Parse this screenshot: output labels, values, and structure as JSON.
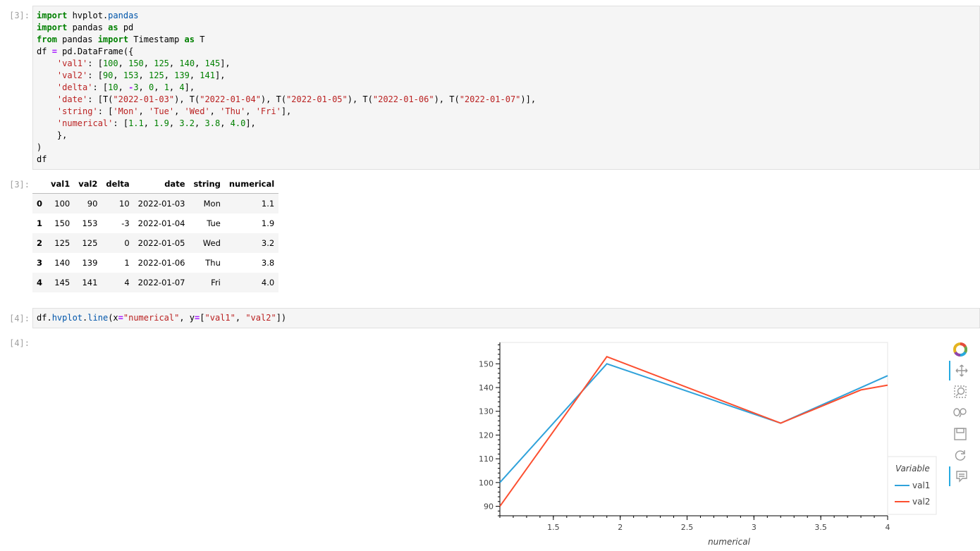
{
  "cells": [
    {
      "prompt": "[3]:",
      "code_lines": [
        "import hvplot.pandas",
        "import pandas as pd",
        "from pandas import Timestamp as T",
        "df = pd.DataFrame({",
        "    'val1': [100, 150, 125, 140, 145],",
        "    'val2': [90, 153, 125, 139, 141],",
        "    'delta': [10, -3, 0, 1, 4],",
        "    'date': [T(\"2022-01-03\"), T(\"2022-01-04\"), T(\"2022-01-05\"), T(\"2022-01-06\"), T(\"2022-01-07\")],",
        "    'string': ['Mon', 'Tue', 'Wed', 'Thu', 'Fri'],",
        "    'numerical': [1.1, 1.9, 3.2, 3.8, 4.0],",
        "    },",
        ")",
        "df"
      ]
    },
    {
      "prompt": "[4]:",
      "code_lines": [
        "df.hvplot.line(x=\"numerical\", y=[\"val1\", \"val2\"])"
      ]
    }
  ],
  "outputs": [
    {
      "prompt": "[3]:"
    },
    {
      "prompt": "[4]:"
    }
  ],
  "dataframe": {
    "columns": [
      "",
      "val1",
      "val2",
      "delta",
      "date",
      "string",
      "numerical"
    ],
    "rows": [
      [
        "0",
        "100",
        "90",
        "10",
        "2022-01-03",
        "Mon",
        "1.1"
      ],
      [
        "1",
        "150",
        "153",
        "-3",
        "2022-01-04",
        "Tue",
        "1.9"
      ],
      [
        "2",
        "125",
        "125",
        "0",
        "2022-01-05",
        "Wed",
        "3.2"
      ],
      [
        "3",
        "140",
        "139",
        "1",
        "2022-01-06",
        "Thu",
        "3.8"
      ],
      [
        "4",
        "145",
        "141",
        "4",
        "2022-01-07",
        "Fri",
        "4.0"
      ]
    ]
  },
  "chart_data": {
    "type": "line",
    "x": [
      1.1,
      1.9,
      3.2,
      3.8,
      4.0
    ],
    "series": [
      {
        "name": "val1",
        "color": "#30a2da",
        "values": [
          100,
          150,
          125,
          140,
          145
        ]
      },
      {
        "name": "val2",
        "color": "#fc4f30",
        "values": [
          90,
          153,
          125,
          139,
          141
        ]
      }
    ],
    "xlabel": "numerical",
    "ylabel": "",
    "xlim": [
      1.1,
      4.0
    ],
    "ylim": [
      86,
      159
    ],
    "xticks": [
      "1.5",
      "2",
      "2.5",
      "3",
      "3.5",
      "4"
    ],
    "yticks": [
      "90",
      "100",
      "110",
      "120",
      "130",
      "140",
      "150"
    ],
    "legend_title": "Variable",
    "legend_placement": "right-bottom",
    "grid": false
  },
  "toolbar": {
    "tools": [
      {
        "icon": "bokeh-logo-icon",
        "active": false
      },
      {
        "icon": "pan-icon",
        "active": true
      },
      {
        "icon": "box-zoom-icon",
        "active": false
      },
      {
        "icon": "wheel-zoom-icon",
        "active": false
      },
      {
        "icon": "save-icon",
        "active": false
      },
      {
        "icon": "reset-icon",
        "active": false
      },
      {
        "icon": "hover-icon",
        "active": true
      }
    ]
  }
}
